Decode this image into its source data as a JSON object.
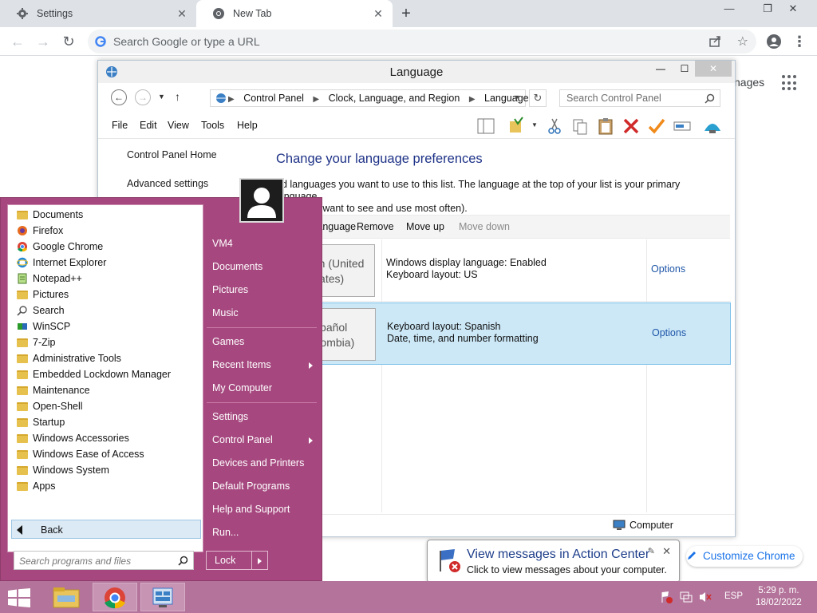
{
  "chrome": {
    "tabs": [
      {
        "label": "Settings",
        "icon": "gear-icon"
      },
      {
        "label": "New Tab",
        "icon": "chrome-icon"
      }
    ],
    "omnibox_placeholder": "Search Google or type a URL",
    "page_fragment": "nages",
    "customize_label": "Customize Chrome"
  },
  "language_window": {
    "title": "Language",
    "breadcrumbs": [
      "Control Panel",
      "Clock, Language, and Region",
      "Language"
    ],
    "search_placeholder": "Search Control Panel",
    "menu": [
      "File",
      "Edit",
      "View",
      "Tools",
      "Help"
    ],
    "left_links": [
      "Control Panel Home",
      "Advanced settings"
    ],
    "heading": "Change your language preferences",
    "description_line1": "dd languages you want to use to this list. The language at the top of your list is your primary language",
    "description_line2": "e one you want to see and use most often).",
    "toolbar": {
      "add": "ld a language",
      "remove": "Remove",
      "move_up": "Move up",
      "move_down": "Move down"
    },
    "languages": [
      {
        "name_line1": "English (United",
        "name_line2": "States)",
        "detail_line1": "Windows display language: Enabled",
        "detail_line2": "Keyboard layout: US",
        "options": "Options"
      },
      {
        "name_line1": "Español",
        "name_line2": "(Colombia)",
        "detail_line1": "Keyboard layout: Spanish",
        "detail_line2": "Date, time, and number formatting",
        "options": "Options"
      }
    ],
    "status_computer": "Computer"
  },
  "start_menu": {
    "programs": [
      "Documents",
      "Firefox",
      "Google Chrome",
      "Internet Explorer",
      "Notepad++",
      "Pictures",
      "Search",
      "WinSCP",
      "7-Zip",
      "Administrative Tools",
      "Embedded Lockdown Manager",
      "Maintenance",
      "Open-Shell",
      "Startup",
      "Windows Accessories",
      "Windows Ease of Access",
      "Windows System",
      "Apps"
    ],
    "back_label": "Back",
    "search_placeholder": "Search programs and files",
    "right_items": [
      "VM4",
      "Documents",
      "Pictures",
      "Music",
      "Games",
      "Recent Items",
      "My Computer",
      "Settings",
      "Control Panel",
      "Devices and Printers",
      "Default Programs",
      "Help and Support",
      "Run..."
    ],
    "lock_label": "Lock"
  },
  "notification": {
    "title": "View messages in Action Center",
    "message": "Click to view messages about your computer."
  },
  "taskbar": {
    "language": "ESP",
    "time": "5:29 p. m.",
    "date": "18/02/2022"
  },
  "colors": {
    "start_menu_bg": "#a6487f",
    "taskbar_bg": "#b3739a",
    "link_blue": "#1e56a8",
    "heading_blue": "#1e3287",
    "selection_bg": "#cce8f7"
  }
}
